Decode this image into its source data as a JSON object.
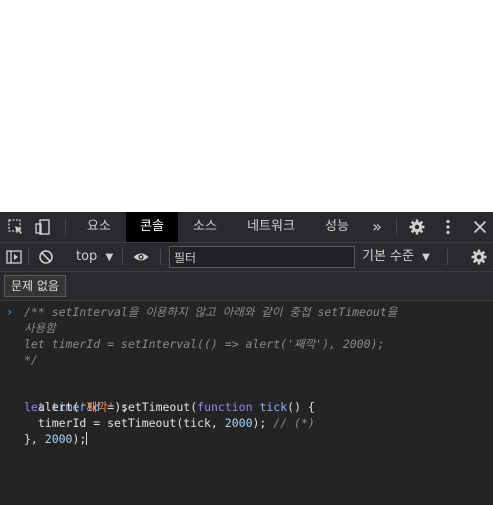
{
  "devtools": {
    "tabs": [
      {
        "label": "요소"
      },
      {
        "label": "콘솔"
      },
      {
        "label": "소스"
      },
      {
        "label": "네트워크"
      },
      {
        "label": "성능"
      }
    ],
    "more_tabs_glyph": "»",
    "toolbar": {
      "context": "top",
      "filter_placeholder": "필터",
      "levels": "기본 수준"
    },
    "issues_label": "문제 없음"
  },
  "console": {
    "lines": [
      "/** setInterval을 이용하지 않고 아래와 같이 중첩 setTimeout을",
      "사용함",
      "let timerId = setInterval(() => alert('째깍'), 2000);",
      "*/"
    ],
    "code": {
      "l1_kw": "let",
      "l1_var": "timerId",
      "l1_eq": " = ",
      "l1_fn": "setTimeout(",
      "l1_kw2": "function",
      "l1_name": " tick",
      "l1_rest": "() {",
      "l2_fn": "  alert(",
      "l2_str": "'째깍'",
      "l2_rest": ");",
      "l3_a": "  timerId = setTimeout(tick, ",
      "l3_num": "2000",
      "l3_b": "); ",
      "l3_cmt": "// (*)",
      "l4_a": "}, ",
      "l4_num": "2000",
      "l4_b": ");"
    }
  }
}
